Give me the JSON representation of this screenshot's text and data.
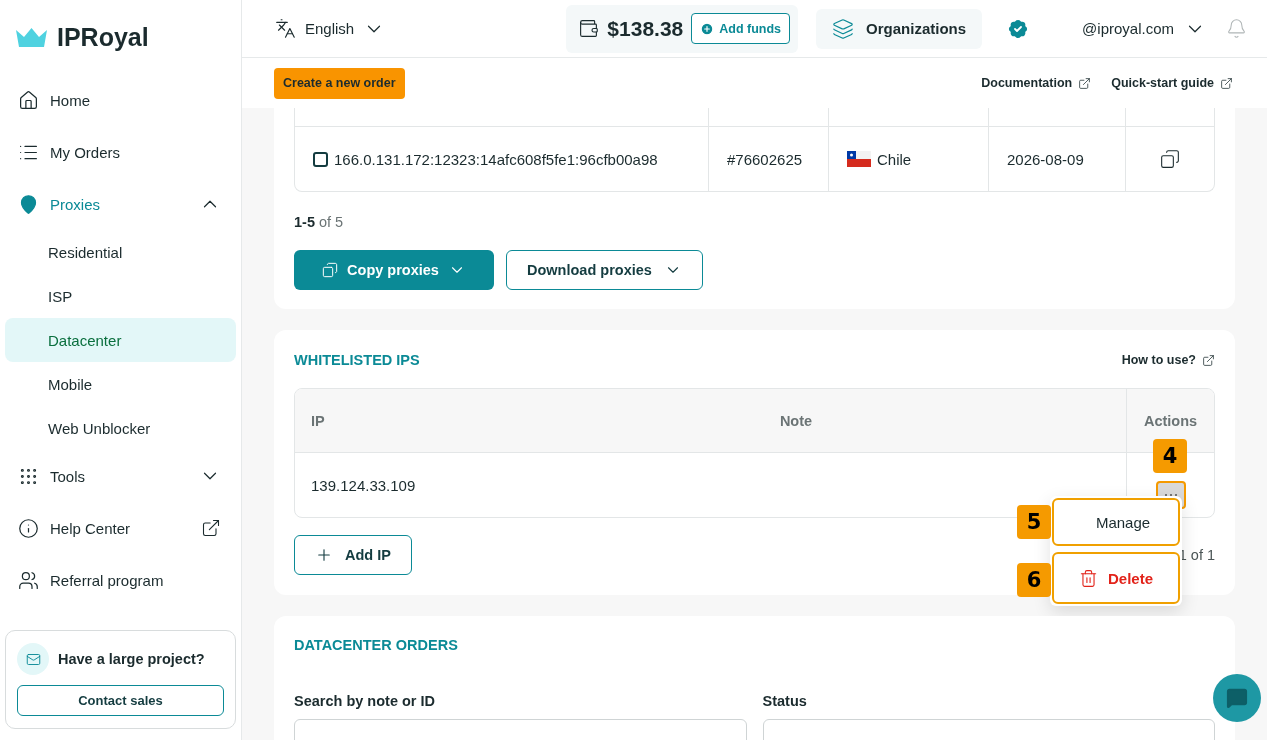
{
  "brand": {
    "name": "IPRoyal"
  },
  "nav": [
    {
      "label": "Home",
      "kind": "home",
      "selected": false
    },
    {
      "label": "My Orders",
      "kind": "orders",
      "selected": false
    },
    {
      "label": "Proxies",
      "kind": "proxies",
      "selected": false,
      "expanded": true,
      "children": [
        {
          "label": "Residential",
          "selected": false
        },
        {
          "label": "ISP",
          "selected": false
        },
        {
          "label": "Datacenter",
          "selected": true
        },
        {
          "label": "Mobile",
          "selected": false
        },
        {
          "label": "Web Unblocker",
          "selected": false
        }
      ]
    },
    {
      "label": "Tools",
      "kind": "tools",
      "selected": false,
      "expanded": false
    },
    {
      "label": "Help Center",
      "kind": "help",
      "selected": false
    },
    {
      "label": "Referral program",
      "kind": "referral",
      "selected": false
    }
  ],
  "promo": {
    "title": "Have a large project?",
    "button": "Contact sales"
  },
  "header": {
    "language": "English",
    "balance": "$138.38",
    "add_funds": "Add funds",
    "organizations": "Organizations",
    "account": "@iproyal.com"
  },
  "subheader": {
    "create_order": "Create a new order",
    "links": [
      "Documentation",
      "Quick-start guide"
    ]
  },
  "proxy_list": {
    "rows": [
      {
        "proxy": "166.0.131.172:12323:14afc608f5fe1:96cfb00a98",
        "order": "#76602625",
        "country": "Chile",
        "expires": "2026-08-09",
        "checked": false
      }
    ],
    "range": "1-5",
    "total": "of 5",
    "copy_button": "Copy proxies",
    "download_button": "Download proxies"
  },
  "whitelist": {
    "title": "WHITELISTED IPS",
    "help_link": "How to use?",
    "columns": [
      "IP",
      "Note",
      "Actions"
    ],
    "rows": [
      {
        "ip": "139.124.33.109",
        "note_text": ""
      }
    ],
    "add_button": "Add IP",
    "pagination": "1 of 1",
    "menu": [
      {
        "label": "Manage",
        "kind": "manage"
      },
      {
        "label": "Delete",
        "kind": "delete"
      }
    ],
    "callouts": [
      "4",
      "5",
      "6"
    ]
  },
  "orders": {
    "title": "DATACENTER ORDERS",
    "filters": [
      "Search by note or ID",
      "Status"
    ]
  }
}
